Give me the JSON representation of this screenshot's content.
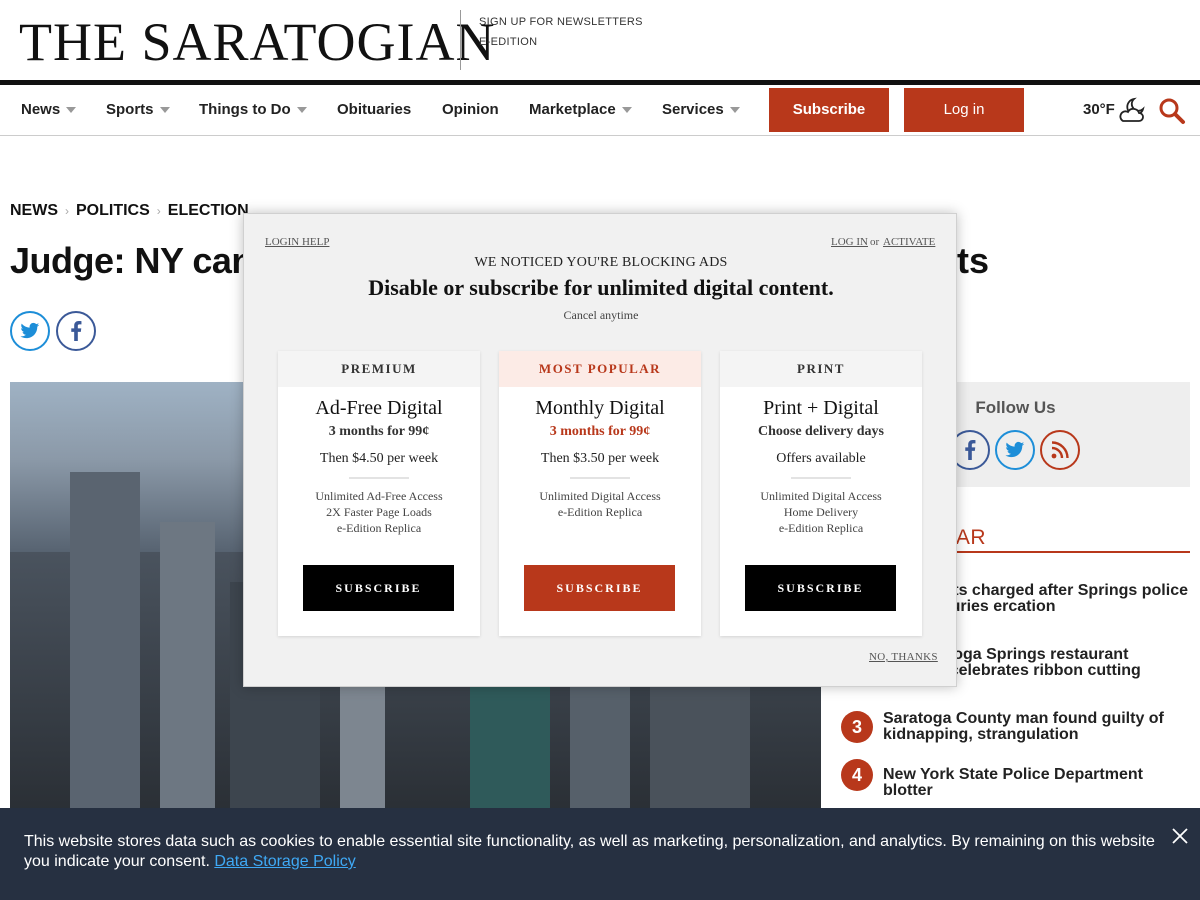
{
  "header": {
    "logo": "THE SARATOGIAN",
    "top_links": [
      "SIGN UP FOR NEWSLETTERS",
      "E-EDITION"
    ]
  },
  "nav": {
    "items": [
      "News",
      "Sports",
      "Things to Do",
      "Obituaries",
      "Opinion",
      "Marketplace",
      "Services"
    ],
    "subscribe_label": "Subscribe",
    "login_label": "Log in",
    "weather_temp": "30°F",
    "weather_icon": "partly-cloudy-night-icon",
    "search_icon": "search-icon",
    "accent_color": "#b8381b"
  },
  "article": {
    "breadcrumb": [
      "NEWS",
      "POLITICS",
      "ELECTION"
    ],
    "headline_start": "Judge: NY can",
    "headline_end": "ts",
    "share": [
      "twitter-icon",
      "facebook-icon"
    ]
  },
  "sidebar": {
    "follow_title": "Follow Us",
    "follow_icons": [
      "facebook-icon",
      "twitter-icon",
      "rss-icon"
    ],
    "popular_title": "ULAR",
    "popular": [
      {
        "num": "",
        "text": "y residents charged after Springs police suffer injuries ercation"
      },
      {
        "num": "",
        "text": "OT: Saratoga Springs restaurant Benelux celebrates ribbon cutting"
      },
      {
        "num": "3",
        "text": "Saratoga County man found guilty of kidnapping, strangulation"
      },
      {
        "num": "4",
        "text": "New York State Police Department blotter"
      }
    ]
  },
  "modal": {
    "login_help": "LOGIN HELP",
    "log_in": "LOG IN",
    "or": "or",
    "activate": "ACTIVATE",
    "notice": "WE NOTICED YOU'RE BLOCKING ADS",
    "headline": "Disable or subscribe for unlimited digital content.",
    "cancel": "Cancel anytime",
    "no_thanks": "NO, THANKS",
    "plans": [
      {
        "tag": "PREMIUM",
        "name": "Ad-Free Digital",
        "offer": "3 months for 99¢",
        "then": "Then $4.50 per week",
        "features": [
          "Unlimited Ad-Free Access",
          "2X Faster Page Loads",
          "e-Edition Replica"
        ],
        "button": "SUBSCRIBE"
      },
      {
        "tag": "MOST POPULAR",
        "name": "Monthly Digital",
        "offer": "3 months for 99¢",
        "then": "Then $3.50 per week",
        "features": [
          "Unlimited Digital Access",
          "e-Edition Replica"
        ],
        "button": "SUBSCRIBE"
      },
      {
        "tag": "PRINT",
        "name": "Print + Digital",
        "offer": "Choose delivery days",
        "then": "Offers available",
        "features": [
          "Unlimited Digital Access",
          "Home Delivery",
          "e-Edition Replica"
        ],
        "button": "SUBSCRIBE"
      }
    ]
  },
  "cookie": {
    "text": "This website stores data such as cookies to enable essential site functionality, as well as marketing, personalization, and analytics. By remaining on this website you indicate your consent.",
    "link": "Data Storage Policy",
    "close_icon": "close-icon"
  }
}
